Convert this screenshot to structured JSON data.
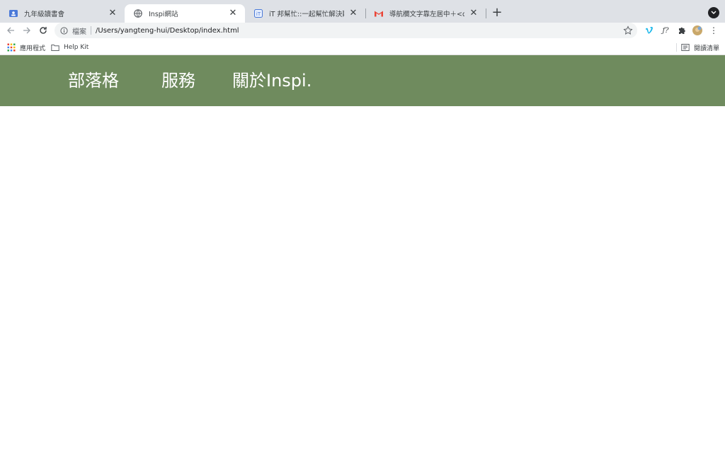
{
  "tabs": [
    {
      "title": "九年級讀書會",
      "icon": "classroom-icon",
      "active": false
    },
    {
      "title": "Inspi網站",
      "icon": "globe-icon",
      "active": true
    },
    {
      "title": "iT 邦幫忙::一起幫忙解決難題，拯",
      "icon": "ithome-icon",
      "active": false
    },
    {
      "title": "導航欄文字靠左居中＋<div>需要",
      "icon": "gmail-icon",
      "active": false
    }
  ],
  "toolbar": {
    "scheme_label": "檔案",
    "url": "/Users/yangteng-hui/Desktop/index.html"
  },
  "bookmarks": {
    "apps_label": "應用程式",
    "help_kit_label": "Help Kit",
    "reading_list_label": "閱讀清單"
  },
  "site": {
    "nav": [
      "部落格",
      "服務",
      "關於Inspi."
    ]
  },
  "colors": {
    "nav_bg": "#6f8b5e",
    "tabstrip_bg": "#dee1e6"
  }
}
